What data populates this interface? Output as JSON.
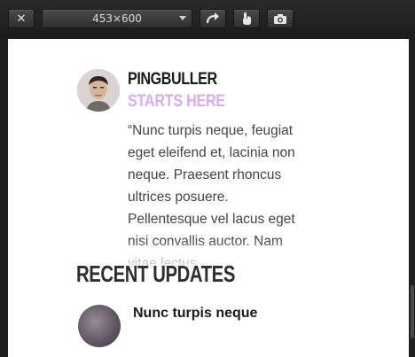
{
  "toolbar": {
    "size_label": "453×600",
    "close_icon": "close-icon",
    "rotate_icon": "rotate-icon",
    "touch_icon": "touch-icon",
    "screenshot_icon": "camera-icon"
  },
  "testimonial": {
    "name": "PINGBULLER",
    "subtitle": "STARTS HERE",
    "quote": "“Nunc turpis neque, feugiat eget eleifend et, lacinia non neque. Praesent rhoncus ultrices posuere. Pellentesque vel lacus eget nisi convallis auctor. Nam vitae lectus"
  },
  "recent": {
    "heading": "RECENT UPDATES",
    "first_title": "Nunc turpis neque"
  }
}
